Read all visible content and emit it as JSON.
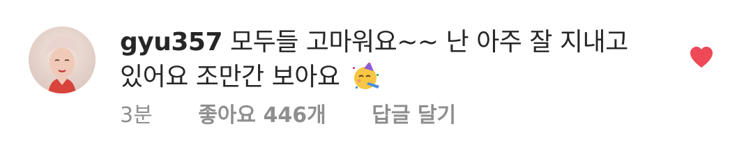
{
  "comment": {
    "username": "gyu357",
    "text": "모두들 고마워요~~ 난 아주 잘 지내고있어요 조만간 보아요",
    "emoji": "partying-face-emoji",
    "time": "3분",
    "likes": "좋아요 446개",
    "reply_label": "답글 달기",
    "liked": true
  },
  "colors": {
    "text": "#262626",
    "secondary": "#8e8e8e",
    "heart": "#ed4956"
  }
}
